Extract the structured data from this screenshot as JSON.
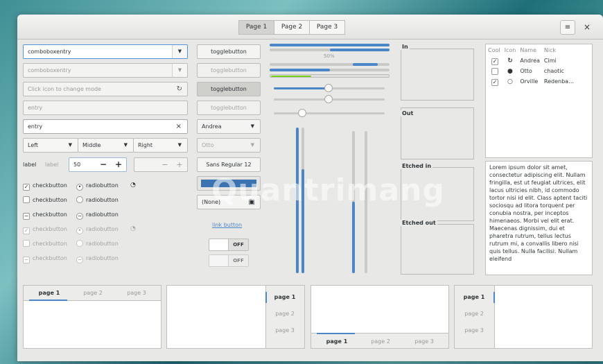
{
  "window": {
    "tabs": [
      {
        "label": "Page 1",
        "selected": true
      },
      {
        "label": "Page 2",
        "selected": false
      },
      {
        "label": "Page 3",
        "selected": false
      }
    ],
    "menu_icon": "hamburger-icon",
    "close_label": "×"
  },
  "left": {
    "combo1": "comboboxentry",
    "combo2": "comboboxentry",
    "mode_placeholder": "Click icon to change mode",
    "entry1": "entry",
    "entry2": "entry",
    "entry_clear": "×",
    "linked": [
      "Left",
      "Middle",
      "Right"
    ],
    "label_a": "label",
    "label_b": "label",
    "spin_value": "50",
    "spin_minus": "−",
    "spin_plus": "+",
    "checks": [
      {
        "label": "checkbutton",
        "state": "checked"
      },
      {
        "label": "checkbutton",
        "state": "unchecked"
      },
      {
        "label": "checkbutton",
        "state": "mixed"
      },
      {
        "label": "checkbutton",
        "state": "checked"
      },
      {
        "label": "checkbutton",
        "state": "unchecked"
      },
      {
        "label": "checkbutton",
        "state": "mixed"
      }
    ],
    "radios": [
      {
        "label": "radiobutton",
        "state": "checked"
      },
      {
        "label": "radiobutton",
        "state": "unchecked"
      },
      {
        "label": "radiobutton",
        "state": "mixed"
      },
      {
        "label": "radiobutton",
        "state": "checked"
      },
      {
        "label": "radiobutton",
        "state": "unchecked"
      },
      {
        "label": "radiobutton",
        "state": "mixed"
      }
    ]
  },
  "mid": {
    "toggles": [
      "togglebutton",
      "togglebutton",
      "togglebutton",
      "togglebutton"
    ],
    "combo_andrea": "Andrea",
    "combo_otto": "Otto",
    "font_button": "Sans Regular  12",
    "file_button": "(None)",
    "link": "link button",
    "switch1": "OFF",
    "switch2": "OFF"
  },
  "sliders": {
    "progress_label": "50%",
    "progress": 0.5
  },
  "frames": [
    "In",
    "Out",
    "Etched in",
    "Etched out"
  ],
  "tree": {
    "headers": [
      "Cool",
      "Icon",
      "Name",
      "Nick"
    ],
    "rows": [
      {
        "cool": true,
        "icon": "reload-icon",
        "name": "Andrea",
        "nick": "Cimi"
      },
      {
        "cool": false,
        "icon": "alert-icon",
        "name": "Otto",
        "nick": "chaotic"
      },
      {
        "cool": true,
        "icon": "circle-icon",
        "name": "Orville",
        "nick": "Redenba…"
      }
    ]
  },
  "lorem": "Lorem ipsum dolor sit amet, consectetur adipiscing elit. Nullam fringilla, est ut feugiat ultrices, elit lacus ultricies nibh, id commodo tortor nisi id elit. Class aptent taciti sociosqu ad litora torquent per conubia nostra, per inceptos himenaeos. Morbi vel elit erat. Maecenas dignissim, dui et pharetra rutrum, tellus lectus rutrum mi, a convallis libero nisi quis tellus. Nulla facilisi. Nullam eleifend",
  "notebooks": {
    "nb1": [
      "page 1",
      "page 2",
      "page 3"
    ],
    "nb2": [
      "page 1",
      "page 2",
      "page 3"
    ],
    "nb3": [
      "page 1",
      "page 2",
      "page 3"
    ],
    "nb4": [
      "page 1",
      "page 2",
      "page 3"
    ]
  },
  "watermark": "Quantrimang"
}
